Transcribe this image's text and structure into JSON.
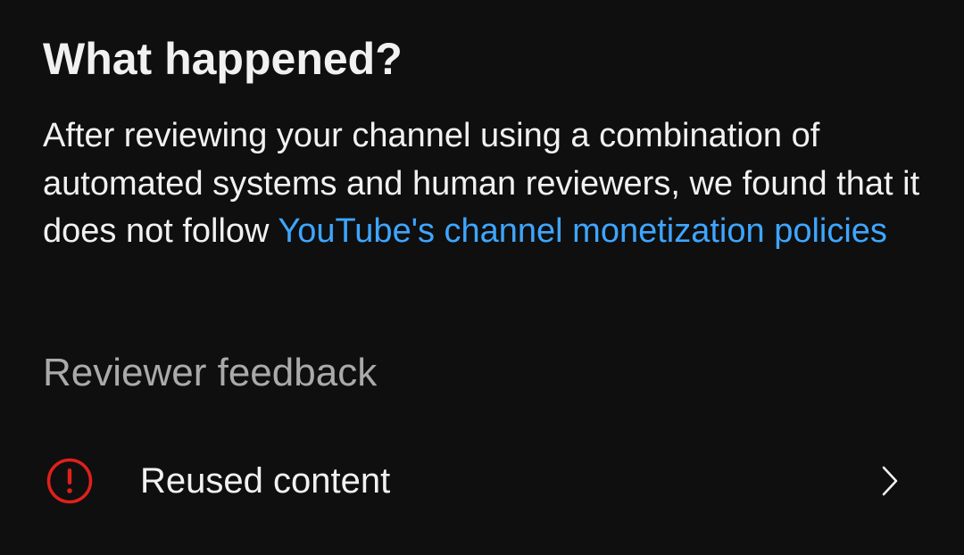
{
  "header": {
    "title": "What happened?"
  },
  "explanation": {
    "text_before_link": "After reviewing your channel using a combination of automated systems and human reviewers, we found that it does not follow ",
    "link_text": "YouTube's channel monetization policies"
  },
  "reviewer_feedback": {
    "heading": "Reviewer feedback",
    "items": [
      {
        "label": "Reused content",
        "icon": "alert-circle-icon",
        "trailing_icon": "chevron-right-icon"
      }
    ]
  },
  "colors": {
    "background": "#0f0f0f",
    "text_primary": "#f1f1f1",
    "text_secondary": "#aaaaaa",
    "link": "#3ea6ff",
    "alert": "#e0201b"
  }
}
